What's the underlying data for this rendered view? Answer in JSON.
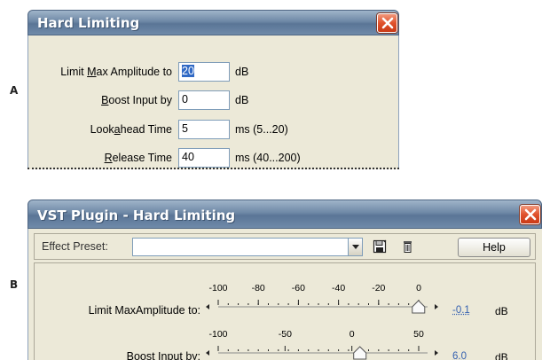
{
  "panel_labels": {
    "a": "A",
    "b": "B"
  },
  "panel_a": {
    "title": "Hard Limiting",
    "rows": [
      {
        "label_pre": "Limit ",
        "label_ul": "M",
        "label_post": "ax Amplitude to",
        "value": "20",
        "unit": "dB"
      },
      {
        "label_pre": "",
        "label_ul": "B",
        "label_post": "oost Input by",
        "value": "0",
        "unit": "dB"
      },
      {
        "label_pre": "Look",
        "label_ul": "a",
        "label_post": "head Time",
        "value": "5",
        "unit": "ms (5...20)"
      },
      {
        "label_pre": "",
        "label_ul": "R",
        "label_post": "elease Time",
        "value": "40",
        "unit": "ms (40...200)"
      }
    ]
  },
  "panel_b": {
    "title": "VST Plugin - Hard Limiting",
    "toolbar": {
      "preset_label": "Effect Preset:",
      "preset_value": "",
      "help_label": "Help",
      "icons": [
        "save-preset-icon",
        "delete-preset-icon"
      ]
    },
    "sliders": [
      {
        "label": "Limit MaxAmplitude to:",
        "ticks": [
          "-100",
          "-80",
          "-60",
          "-40",
          "-20",
          "0"
        ],
        "min": -100,
        "max": 0,
        "value": -0.1,
        "value_text": "-0.1",
        "unit": "dB"
      },
      {
        "label": "Boost Input by:",
        "ticks": [
          "-100",
          "-50",
          "0",
          "50"
        ],
        "min": -100,
        "max": 50,
        "value": 6.0,
        "value_text": "6.0",
        "unit": "dB"
      }
    ]
  },
  "colors": {
    "close_red": "#e0512c",
    "title_blue": "#6e88a6",
    "link_blue": "#3460b0"
  }
}
